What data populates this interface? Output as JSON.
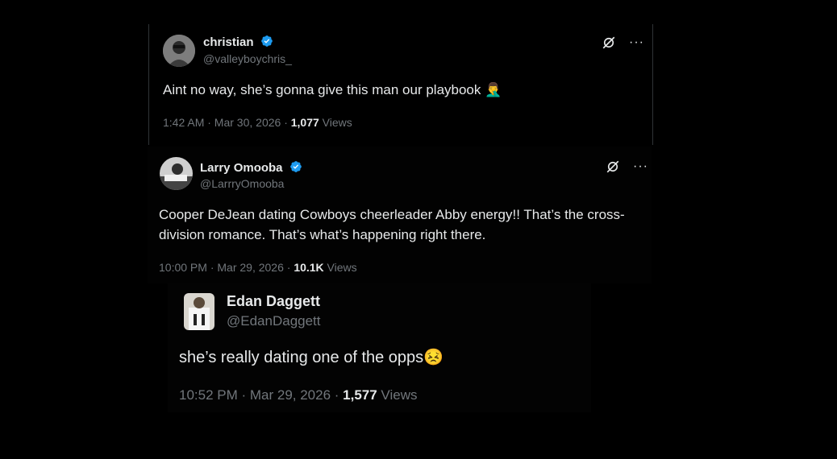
{
  "tweets": [
    {
      "name": "christian",
      "handle": "@valleyboychris_",
      "text": "Aint no way, she’s gonna give this man our playbook 🤦‍♂️",
      "time": "1:42 AM · Mar 30, 2026 · ",
      "views_count": "1,077",
      "views_label": " Views",
      "verified": true
    },
    {
      "name": "Larry Omooba",
      "handle": "@LarrryOmooba",
      "text": "Cooper DeJean dating Cowboys cheerleader Abby energy!! That’s the cross-division romance. That’s what’s happening right there.",
      "time": "10:00 PM · Mar 29, 2026 · ",
      "views_count": "10.1K",
      "views_label": " Views",
      "verified": true
    },
    {
      "name": "Edan Daggett",
      "handle": "@EdanDaggett",
      "text": "she’s really dating one of the opps😣",
      "time": "10:52 PM · Mar 29, 2026 · ",
      "views_count": "1,577",
      "views_label": " Views",
      "verified": false
    }
  ],
  "icons": {
    "grok": "grok-icon",
    "more": "more-options-icon",
    "verified": "verified-badge-icon"
  },
  "colors": {
    "background": "#000000",
    "text": "#e7e9ea",
    "secondary": "#71767b",
    "verified": "#1d9bf0"
  }
}
